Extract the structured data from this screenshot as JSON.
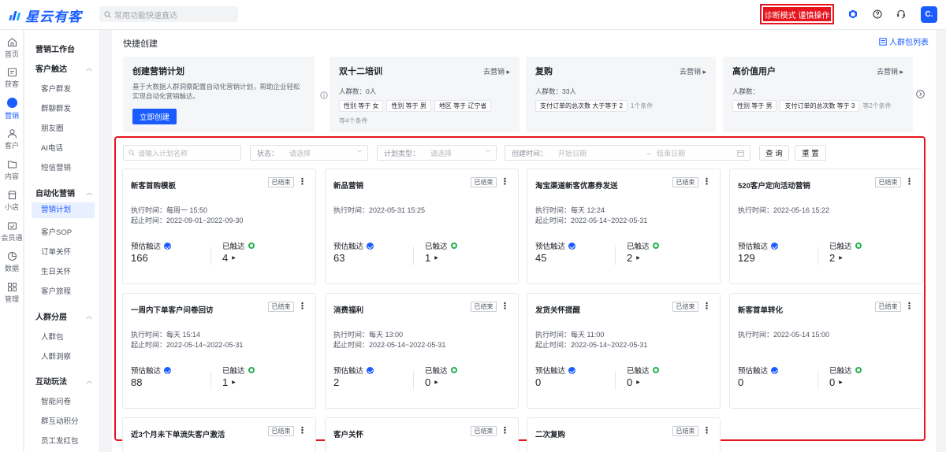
{
  "brand": "星云有客",
  "top_search_placeholder": "常用功能快速直达",
  "diag_button": "诊断模式 谨慎操作",
  "avatar": "C.",
  "rail": [
    {
      "label": "首页",
      "icon": "home-icon"
    },
    {
      "label": "获客",
      "icon": "acquire-icon"
    },
    {
      "label": "营销",
      "icon": "marketing-icon"
    },
    {
      "label": "客户",
      "icon": "customer-icon"
    },
    {
      "label": "内容",
      "icon": "content-icon"
    },
    {
      "label": "小店",
      "icon": "shop-icon"
    },
    {
      "label": "会员通",
      "icon": "member-icon"
    },
    {
      "label": "数据",
      "icon": "data-icon"
    },
    {
      "label": "管理",
      "icon": "manage-icon"
    }
  ],
  "submenu": {
    "workbench": "营销工作台",
    "groups": [
      {
        "title": "客户触达",
        "items": [
          "客户群发",
          "群聊群发",
          "朋友圈",
          "AI电话",
          "短信营销"
        ]
      },
      {
        "title": "自动化营销",
        "items": [
          "营销计划",
          "客户SOP",
          "订单关怀",
          "生日关怀",
          "客户旅程"
        ]
      },
      {
        "title": "人群分层",
        "items": [
          "人群包",
          "人群洞察"
        ]
      },
      {
        "title": "互动玩法",
        "items": [
          "智能问卷",
          "群互动积分",
          "员工发红包"
        ]
      }
    ]
  },
  "main": {
    "section_title": "快捷创建",
    "audience_link": "人群包列表",
    "create_card": {
      "title": "创建营销计划",
      "desc": "基于大数据人群洞察配置自动化营销计划，帮助企业轻松实现自动化营销触达。",
      "button": "立即创建"
    },
    "go_label": "去营销",
    "quick_cards": [
      {
        "title": "双十二培训",
        "count": "人群数：0人",
        "tags": [
          "性别 等于 女",
          "性别 等于 男",
          "地区 等于 辽宁省"
        ],
        "more": "等4个条件"
      },
      {
        "title": "复购",
        "count": "人群数：33人",
        "tags": [
          "支付订单的总次数 大于等于 2"
        ],
        "more": "1个条件"
      },
      {
        "title": "高价值用户",
        "count": "人群数：",
        "tags": [
          "性别 等于 男",
          "支付订单的总次数 等于 3"
        ],
        "more": "等2个条件"
      }
    ],
    "filter": {
      "name_placeholder": "请输入计划名称",
      "status_label": "状态：",
      "status_placeholder": "请选择",
      "type_label": "计划类型：",
      "type_placeholder": "请选择",
      "time_label": "创建时间：",
      "start_placeholder": "开始日期",
      "end_placeholder": "结束日期",
      "query": "查 询",
      "reset": "重 置"
    },
    "metric_labels": {
      "estimated": "预估触达",
      "reached": "已触达"
    },
    "plans": [
      {
        "title": "新客首购模板",
        "status": "已结束",
        "exec": "执行时间：每周一 15:50",
        "range": "起止时间：2022-09-01~2022-09-30",
        "estimated": "166",
        "reached": "4"
      },
      {
        "title": "新品营销",
        "status": "已结束",
        "exec": "执行时间：2022-05-31 15:25",
        "range": "",
        "estimated": "63",
        "reached": "1"
      },
      {
        "title": "淘宝渠道新客优惠券发送",
        "status": "已结束",
        "exec": "执行时间：每天 12:24",
        "range": "起止时间：2022-05-14~2022-05-31",
        "estimated": "45",
        "reached": "2"
      },
      {
        "title": "520客户定向活动营销",
        "status": "已结束",
        "exec": "执行时间：2022-05-16 15:22",
        "range": "",
        "estimated": "129",
        "reached": "2"
      },
      {
        "title": "一周内下单客户问卷回访",
        "status": "已结束",
        "exec": "执行时间：每天 15:14",
        "range": "起止时间：2022-05-14~2022-05-31",
        "estimated": "88",
        "reached": "1"
      },
      {
        "title": "消费福利",
        "status": "已结束",
        "exec": "执行时间：每天 13:00",
        "range": "起止时间：2022-05-14~2022-05-31",
        "estimated": "2",
        "reached": "0"
      },
      {
        "title": "发货关怀提醒",
        "status": "已结束",
        "exec": "执行时间：每天 11:00",
        "range": "起止时间：2022-05-14~2022-05-31",
        "estimated": "0",
        "reached": "0"
      },
      {
        "title": "新客首单转化",
        "status": "已结束",
        "exec": "执行时间：2022-05-14 15:00",
        "range": "",
        "estimated": "0",
        "reached": "0"
      },
      {
        "title": "近3个月未下单流失客户激活",
        "status": "已结束",
        "exec": "",
        "range": "",
        "estimated": "",
        "reached": ""
      },
      {
        "title": "客户关怀",
        "status": "已结束",
        "exec": "",
        "range": "",
        "estimated": "",
        "reached": ""
      },
      {
        "title": "二次复购",
        "status": "已结束",
        "exec": "",
        "range": "",
        "estimated": "",
        "reached": ""
      }
    ]
  }
}
